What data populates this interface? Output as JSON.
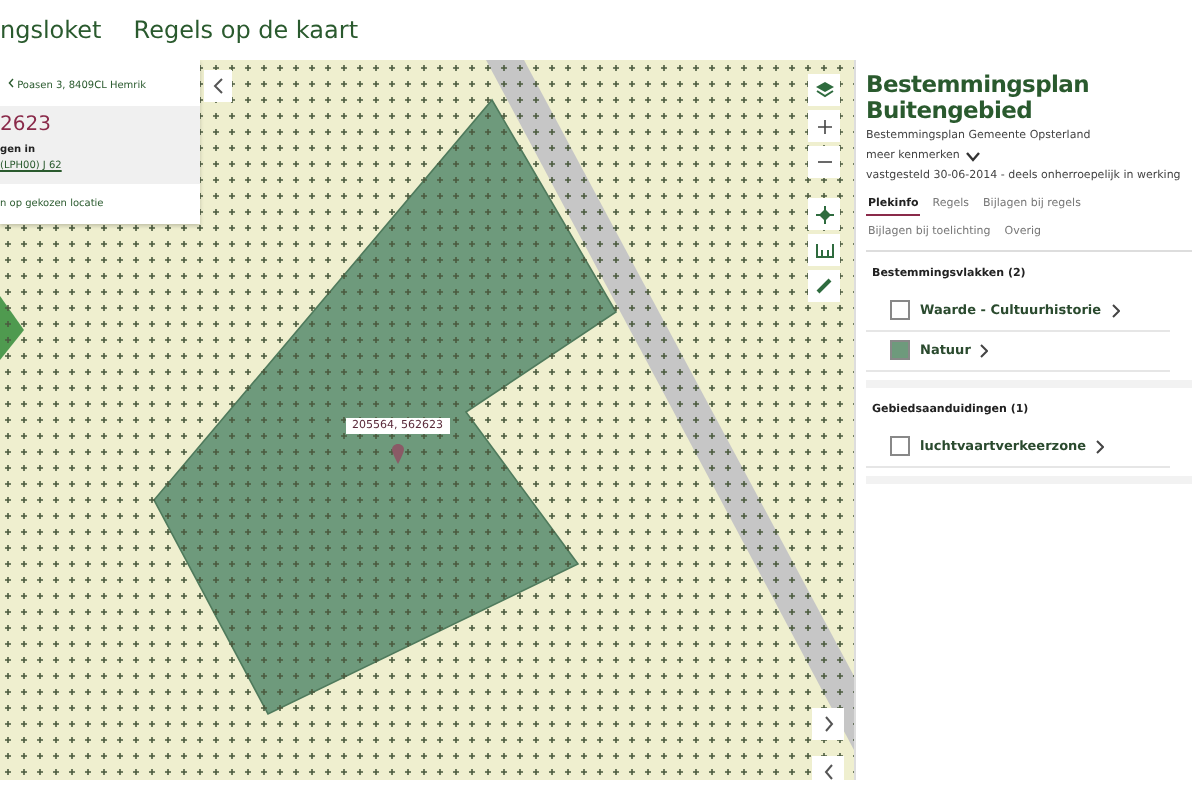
{
  "header": {
    "title": "ngsloket",
    "nav": [
      {
        "label": "Regels op de kaart"
      }
    ]
  },
  "location_card": {
    "back_link": "Poasen 3, 8409CL Hemrik",
    "coordinate": "2623",
    "label": "gen in",
    "link": "(LPH00) J 62",
    "footer": "n op gekozen locatie"
  },
  "map": {
    "marker_label": "205564, 562623"
  },
  "plan": {
    "title": "Bestemmingsplan Buitengebied",
    "subtitle": "Bestemmingsplan  Gemeente Opsterland",
    "more": "meer kenmerken",
    "status": "vastgesteld 30-06-2014 - deels onherroepelijk in werking",
    "tabs": [
      {
        "label": "Plekinfo",
        "selected": true
      },
      {
        "label": "Regels",
        "selected": false
      },
      {
        "label": "Bijlagen bij regels",
        "selected": false
      },
      {
        "label": "Bijlagen bij toelichting",
        "selected": false
      },
      {
        "label": "Overig",
        "selected": false
      }
    ],
    "sections": [
      {
        "title": "Bestemmingsvlakken (2)",
        "items": [
          {
            "label": "Waarde - Cultuurhistorie",
            "color": "#ffffff"
          },
          {
            "label": "Natuur",
            "color": "#6e9a7c"
          }
        ]
      },
      {
        "title": "Gebiedsaanduidingen (1)",
        "items": [
          {
            "label": "luchtvaartverkeerzone",
            "color": "#ffffff"
          }
        ]
      }
    ]
  }
}
